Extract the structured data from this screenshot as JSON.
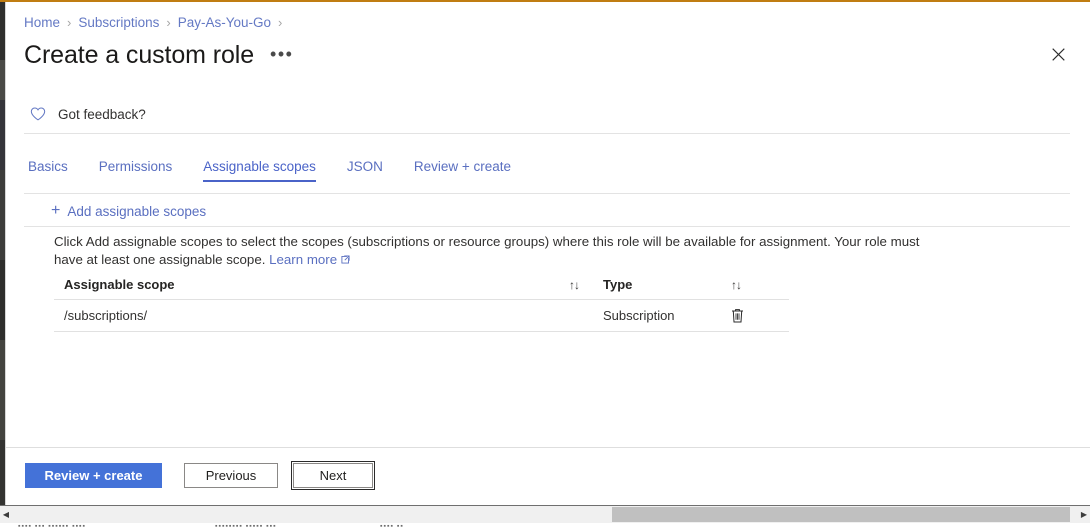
{
  "window": {
    "accent_color": "#c07d12"
  },
  "breadcrumb": {
    "separator": "›",
    "items": [
      {
        "label": "Home"
      },
      {
        "label": "Subscriptions"
      },
      {
        "label": "Pay-As-You-Go"
      }
    ]
  },
  "header": {
    "title": "Create a custom role",
    "more_label": "•••",
    "close_label": "✕"
  },
  "feedback": {
    "icon": "heart-icon",
    "label": "Got feedback?"
  },
  "tabs": [
    {
      "label": "Basics",
      "active": false
    },
    {
      "label": "Permissions",
      "active": false
    },
    {
      "label": "Assignable scopes",
      "active": true
    },
    {
      "label": "JSON",
      "active": false
    },
    {
      "label": "Review + create",
      "active": false
    }
  ],
  "command_bar": {
    "add_icon": "+",
    "add_label": "Add assignable scopes"
  },
  "description": {
    "text_before": "Click Add assignable scopes to select the scopes (subscriptions or resource groups) where this role will be available for assignment. Your role must have at least one assignable scope. ",
    "link_label": "Learn more",
    "link_icon": "external-link-icon"
  },
  "table": {
    "columns": [
      {
        "label": "Assignable scope",
        "sortable": true,
        "sort_icon": "↑↓"
      },
      {
        "label": "Type",
        "sortable": true,
        "sort_icon": "↑↓"
      }
    ],
    "rows": [
      {
        "scope": "/subscriptions/",
        "type": "Subscription",
        "delete_icon": "trash-icon"
      }
    ]
  },
  "footer": {
    "review_label": "Review + create",
    "previous_label": "Previous",
    "next_label": "Next"
  },
  "scrollbar": {
    "left_arrow": "◀",
    "right_arrow": "▶"
  },
  "colors": {
    "primary_button": "#4472d8",
    "link": "#5a6fc0",
    "active_tab": "#4a63c8",
    "top_accent": "#c07d12"
  }
}
